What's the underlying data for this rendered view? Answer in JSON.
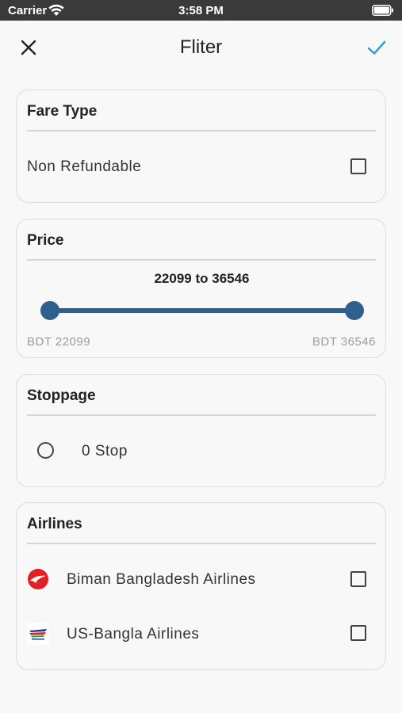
{
  "status_bar": {
    "carrier": "Carrier",
    "time": "3:58 PM"
  },
  "app_bar": {
    "title": "Fliter",
    "accent_color": "#2e9fd8"
  },
  "fare_type": {
    "title": "Fare Type",
    "options": [
      {
        "label": "Non Refundable",
        "checked": false
      }
    ]
  },
  "price": {
    "title": "Price",
    "range_text": "22099 to 36546",
    "min_label": "BDT 22099",
    "max_label": "BDT 36546",
    "min_value": 22099,
    "max_value": 36546,
    "selected_min": 22099,
    "selected_max": 36546,
    "slider_color": "#2f5f8d"
  },
  "stoppage": {
    "title": "Stoppage",
    "options": [
      {
        "label": "0 Stop",
        "selected": false
      }
    ]
  },
  "airlines": {
    "title": "Airlines",
    "items": [
      {
        "label": "Biman Bangladesh Airlines",
        "logo": "biman-logo-icon",
        "checked": false
      },
      {
        "label": "US-Bangla Airlines",
        "logo": "us-bangla-logo-icon",
        "checked": false
      }
    ]
  }
}
